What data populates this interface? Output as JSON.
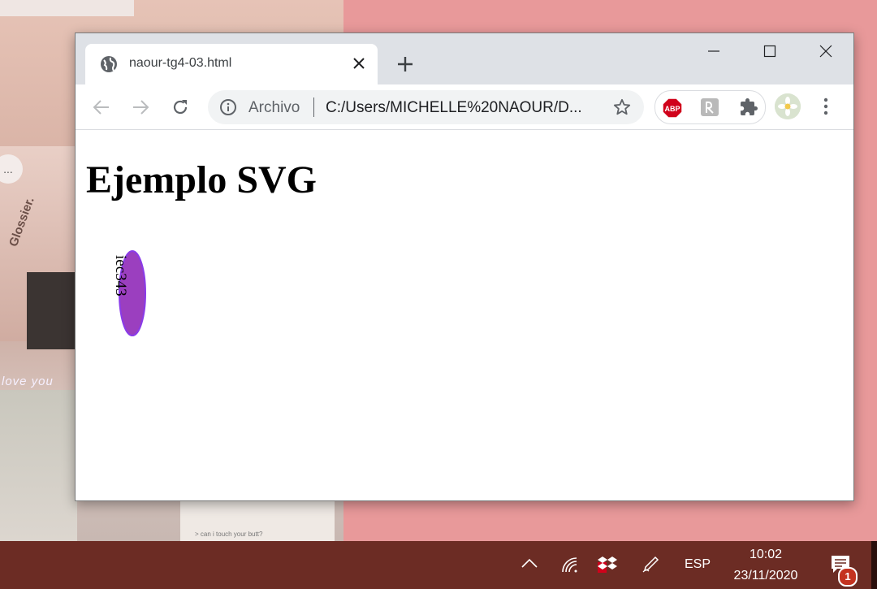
{
  "browser": {
    "tab_title": "naour-tg4-03.html",
    "omnibox": {
      "scheme_label": "Archivo",
      "url": "C:/Users/MICHELLE%20NAOUR/D..."
    },
    "extensions": [
      "adblock-plus-icon",
      "extension-icon",
      "puzzle-icon"
    ],
    "colors": {
      "tabstrip": "#dee1e6",
      "toolbar": "#ffffff"
    }
  },
  "page": {
    "heading": "Ejemplo SVG",
    "svg_shape": {
      "text": "iec343",
      "fill": "#9b3fbf",
      "stroke": "#8a3be8"
    }
  },
  "wallpaper": {
    "text_love": "love you",
    "text_glossier": "Glossier.",
    "text_small": "> can i touch your butt?",
    "menu_dots": "..."
  },
  "taskbar": {
    "language": "ESP",
    "time": "10:02",
    "date": "23/11/2020",
    "notification_count": "1",
    "color": "#6c2c24"
  }
}
